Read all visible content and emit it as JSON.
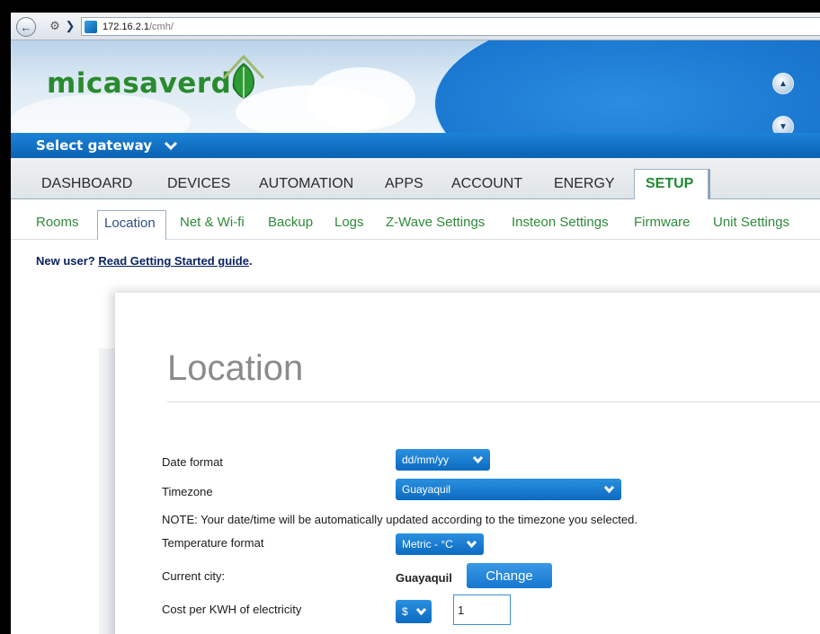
{
  "browser": {
    "url_host": "172.16.2.1",
    "url_path": "/cmh/"
  },
  "brand": {
    "logo_text": "micasaverde",
    "accent": "#1573c9",
    "green": "#2a8a2e"
  },
  "gateway": {
    "label": "Select gateway"
  },
  "main_nav": {
    "items": [
      "DASHBOARD",
      "DEVICES",
      "AUTOMATION",
      "APPS",
      "ACCOUNT",
      "ENERGY"
    ],
    "active": "SETUP"
  },
  "sub_nav": {
    "items": [
      "Rooms",
      "Net & Wi-fi",
      "Backup",
      "Logs",
      "Z-Wave Settings",
      "Insteon Settings",
      "Firmware",
      "Unit Settings"
    ],
    "active": "Location"
  },
  "new_user": {
    "prefix": "New user?",
    "link": "Read Getting Started guide",
    "suffix": "."
  },
  "location": {
    "title": "Location",
    "date_format_label": "Date format",
    "date_format_value": "dd/mm/yy",
    "timezone_label": "Timezone",
    "timezone_value": "Guayaquil",
    "note": "NOTE: Your date/time will be automatically updated according to the timezone you selected.",
    "temperature_label": "Temperature format",
    "temperature_value": "Metric - °C",
    "city_label": "Current city:",
    "city_value": "Guayaquil",
    "change_label": "Change",
    "cost_label": "Cost per KWH of electricity",
    "currency_value": "$",
    "cost_value": "1"
  }
}
